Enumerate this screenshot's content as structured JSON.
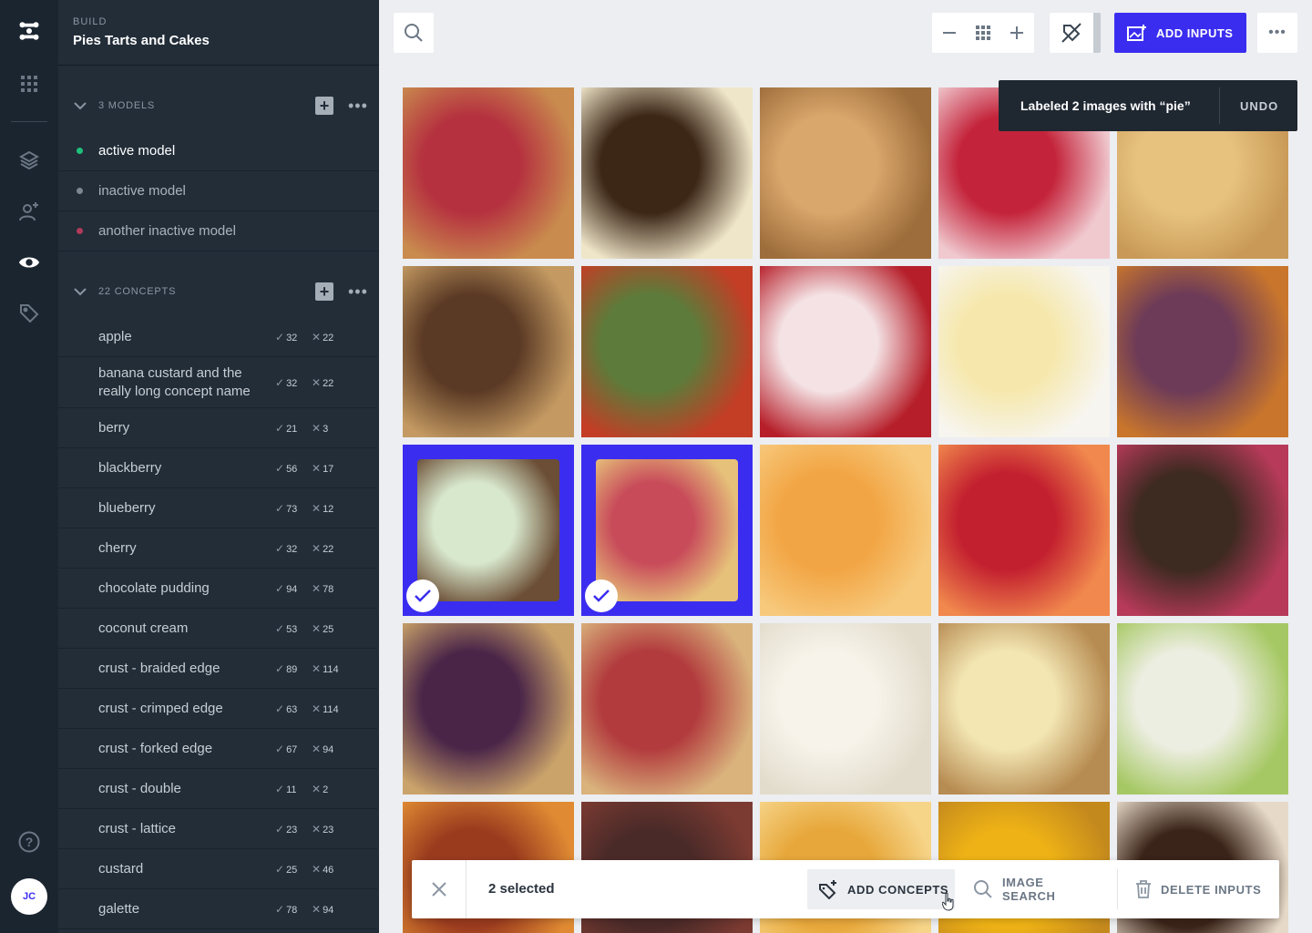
{
  "colors": {
    "accent": "#3b2df0",
    "rail": "#1b2530",
    "sidebar": "#222d38",
    "active_dot": "#1fc07a",
    "inactive_dot": "#7d8792",
    "inactive_dot_alt": "#b03a5a"
  },
  "rail": {
    "icons": [
      "logo-icon",
      "apps-grid-icon",
      "layers-icon",
      "add-user-icon",
      "eye-icon",
      "tag-icon",
      "help-icon"
    ],
    "avatar": "JC"
  },
  "sidebar": {
    "eyebrow": "BUILD",
    "title": "Pies Tarts and Cakes",
    "models_header": "3 MODELS",
    "models": [
      {
        "name": "active model",
        "status": "active"
      },
      {
        "name": "inactive model",
        "status": "inactive"
      },
      {
        "name": "another inactive model",
        "status": "inactive-alt"
      }
    ],
    "concepts_header": "22 CONCEPTS",
    "concepts": [
      {
        "name": "apple",
        "pos": "32",
        "neg": "22"
      },
      {
        "name": "banana custard and the really long concept name",
        "pos": "32",
        "neg": "22"
      },
      {
        "name": "berry",
        "pos": "21",
        "neg": "3"
      },
      {
        "name": "blackberry",
        "pos": "56",
        "neg": "17"
      },
      {
        "name": "blueberry",
        "pos": "73",
        "neg": "12"
      },
      {
        "name": "cherry",
        "pos": "32",
        "neg": "22"
      },
      {
        "name": "chocolate pudding",
        "pos": "94",
        "neg": "78"
      },
      {
        "name": "coconut cream",
        "pos": "53",
        "neg": "25"
      },
      {
        "name": "crust - braided edge",
        "pos": "89",
        "neg": "114"
      },
      {
        "name": "crust - crimped edge",
        "pos": "63",
        "neg": "114"
      },
      {
        "name": "crust - forked edge",
        "pos": "67",
        "neg": "94"
      },
      {
        "name": "crust - double",
        "pos": "11",
        "neg": "2"
      },
      {
        "name": "crust - lattice",
        "pos": "23",
        "neg": "23"
      },
      {
        "name": "custard",
        "pos": "25",
        "neg": "46"
      },
      {
        "name": "galette",
        "pos": "78",
        "neg": "94"
      }
    ]
  },
  "toolbar": {
    "add_inputs_label": "ADD INPUTS",
    "icons": [
      "search-icon",
      "zoom-out-icon",
      "grid-view-icon",
      "zoom-in-icon",
      "hide-labels-icon",
      "more-icon"
    ]
  },
  "grid": {
    "tiles": [
      {
        "colors": [
          "#b5313f",
          "#c98b4e"
        ],
        "selected": false
      },
      {
        "colors": [
          "#3c2616",
          "#efe6c9"
        ],
        "selected": false
      },
      {
        "colors": [
          "#d9a66b",
          "#9d6d3b"
        ],
        "selected": false
      },
      {
        "colors": [
          "#c4243b",
          "#f0c9cf"
        ],
        "selected": false
      },
      {
        "colors": [
          "#e7c27f",
          "#c99a57"
        ],
        "selected": false
      },
      {
        "colors": [
          "#5b3a25",
          "#c49a62"
        ],
        "selected": false
      },
      {
        "colors": [
          "#5d7b3a",
          "#c43d25"
        ],
        "selected": false
      },
      {
        "colors": [
          "#f4e2e4",
          "#b61f2a"
        ],
        "selected": false
      },
      {
        "colors": [
          "#f6e8ad",
          "#f7f5ef"
        ],
        "selected": false
      },
      {
        "colors": [
          "#6d3b58",
          "#c9762c"
        ],
        "selected": false
      },
      {
        "colors": [
          "#d8e8cd",
          "#6b4e35"
        ],
        "selected": true
      },
      {
        "colors": [
          "#c84b5a",
          "#e6c17a"
        ],
        "selected": true
      },
      {
        "colors": [
          "#f2a544",
          "#f7c97c"
        ],
        "selected": false
      },
      {
        "colors": [
          "#c3202f",
          "#f1884d"
        ],
        "selected": false
      },
      {
        "colors": [
          "#3d2a20",
          "#b73a5a"
        ],
        "selected": false
      },
      {
        "colors": [
          "#4a2548",
          "#caa36a"
        ],
        "selected": false
      },
      {
        "colors": [
          "#b23b3d",
          "#d9b27c"
        ],
        "selected": false
      },
      {
        "colors": [
          "#f7f3ea",
          "#e2dccc"
        ],
        "selected": false
      },
      {
        "colors": [
          "#f3e6b3",
          "#b78c52"
        ],
        "selected": false
      },
      {
        "colors": [
          "#edeee2",
          "#a6c864"
        ],
        "selected": false
      },
      {
        "colors": [
          "#9a3b1e",
          "#e08b33"
        ],
        "selected": false
      },
      {
        "colors": [
          "#4a2a28",
          "#7c3b32"
        ],
        "selected": false
      },
      {
        "colors": [
          "#e7a73a",
          "#f6d488"
        ],
        "selected": false
      },
      {
        "colors": [
          "#eeb216",
          "#c4891d"
        ],
        "selected": false
      },
      {
        "colors": [
          "#3a2318",
          "#e6d9c8"
        ],
        "selected": false
      }
    ]
  },
  "toast": {
    "message": "Labeled 2 images with “pie”",
    "undo": "UNDO"
  },
  "actionbar": {
    "count": "2 selected",
    "add_concepts": "ADD CONCEPTS",
    "image_search": "IMAGE SEARCH",
    "delete_inputs": "DELETE INPUTS"
  }
}
